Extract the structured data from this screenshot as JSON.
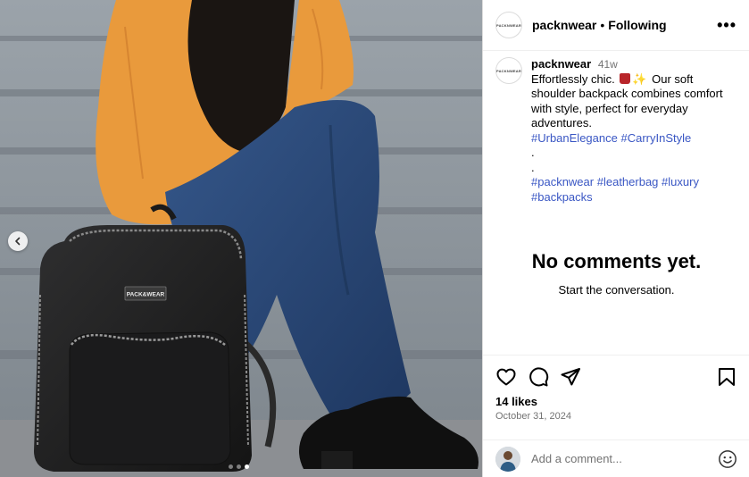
{
  "post": {
    "username": "packnwear",
    "separator": "•",
    "follow_status": "Following",
    "more_label": "•••",
    "logo_text": "PACKNWEAR",
    "time_ago": "41w",
    "caption_line1": "Effortlessly chic.",
    "caption_line2": "Our soft shoulder backpack combines comfort with style, perfect for everyday adventures.",
    "hashtags_a": [
      "#UrbanElegance",
      "#CarryInStyle"
    ],
    "dot_lines": [
      ".",
      "."
    ],
    "hashtags_b": [
      "#packnwear",
      "#leatherbag",
      "#luxury",
      "#backpacks"
    ],
    "photo_bag_label": "PACK&WEAR"
  },
  "comments": {
    "empty_title": "No comments yet.",
    "empty_subtitle": "Start the conversation."
  },
  "stats": {
    "likes": "14 likes",
    "date": "October 31, 2024"
  },
  "comment_box": {
    "placeholder": "Add a comment..."
  },
  "colors": {
    "hashtag": "#3a57c4",
    "sweater": "#e99a3c",
    "jeans": "#2b4a7a",
    "steps": "#8b939a"
  },
  "icons": {
    "prev": "chevron-left-icon",
    "like": "heart-icon",
    "comment": "comment-icon",
    "share": "share-icon",
    "save": "bookmark-icon",
    "emoji": "emoji-icon"
  },
  "carousel": {
    "current": 3,
    "total": 3
  }
}
